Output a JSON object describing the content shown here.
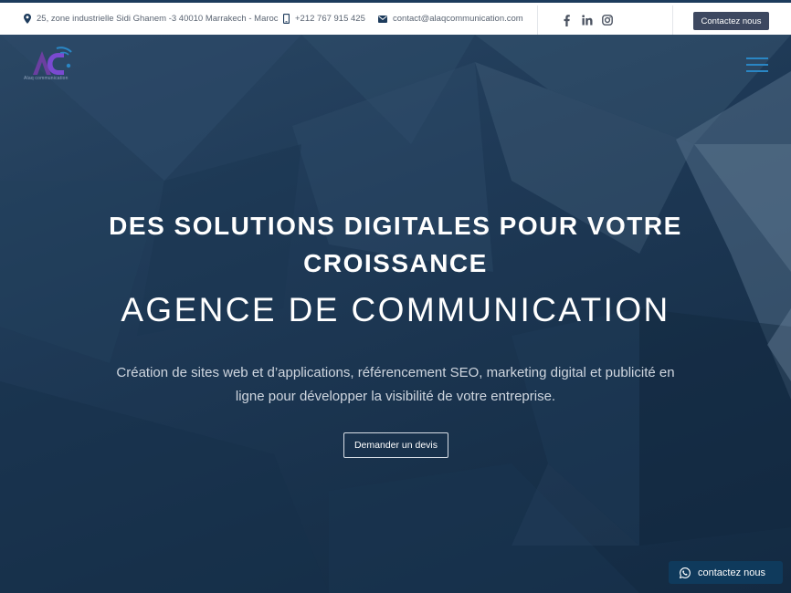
{
  "topbar": {
    "address": "25, zone industrielle Sidi Ghanem -3 40010 Marrakech - Maroc",
    "phone": "+212 767 915 425",
    "email": "contact@alaqcommunication.com",
    "social_icons": [
      "facebook-icon",
      "linkedin-icon",
      "instagram-icon"
    ],
    "cta_label": "Contactez nous"
  },
  "header": {
    "logo_text": "Alaq communication"
  },
  "hero": {
    "headline": "DES SOLUTIONS DIGITALES POUR VOTRE CROISSANCE",
    "subheadline": "AGENCE DE COMMUNICATION",
    "description": "Création de sites web et d’applications, référencement SEO, marketing digital et publicité en ligne pour développer la visibilité de votre entreprise.",
    "button_label": "Demander un devis"
  },
  "floating": {
    "whatsapp_label": "contactez nous"
  },
  "colors": {
    "accent": "#2a86c4",
    "hero_bg": "#1f3a57",
    "top_cta_bg": "#3d4860",
    "whatsapp_bg": "#0f3a5c"
  }
}
